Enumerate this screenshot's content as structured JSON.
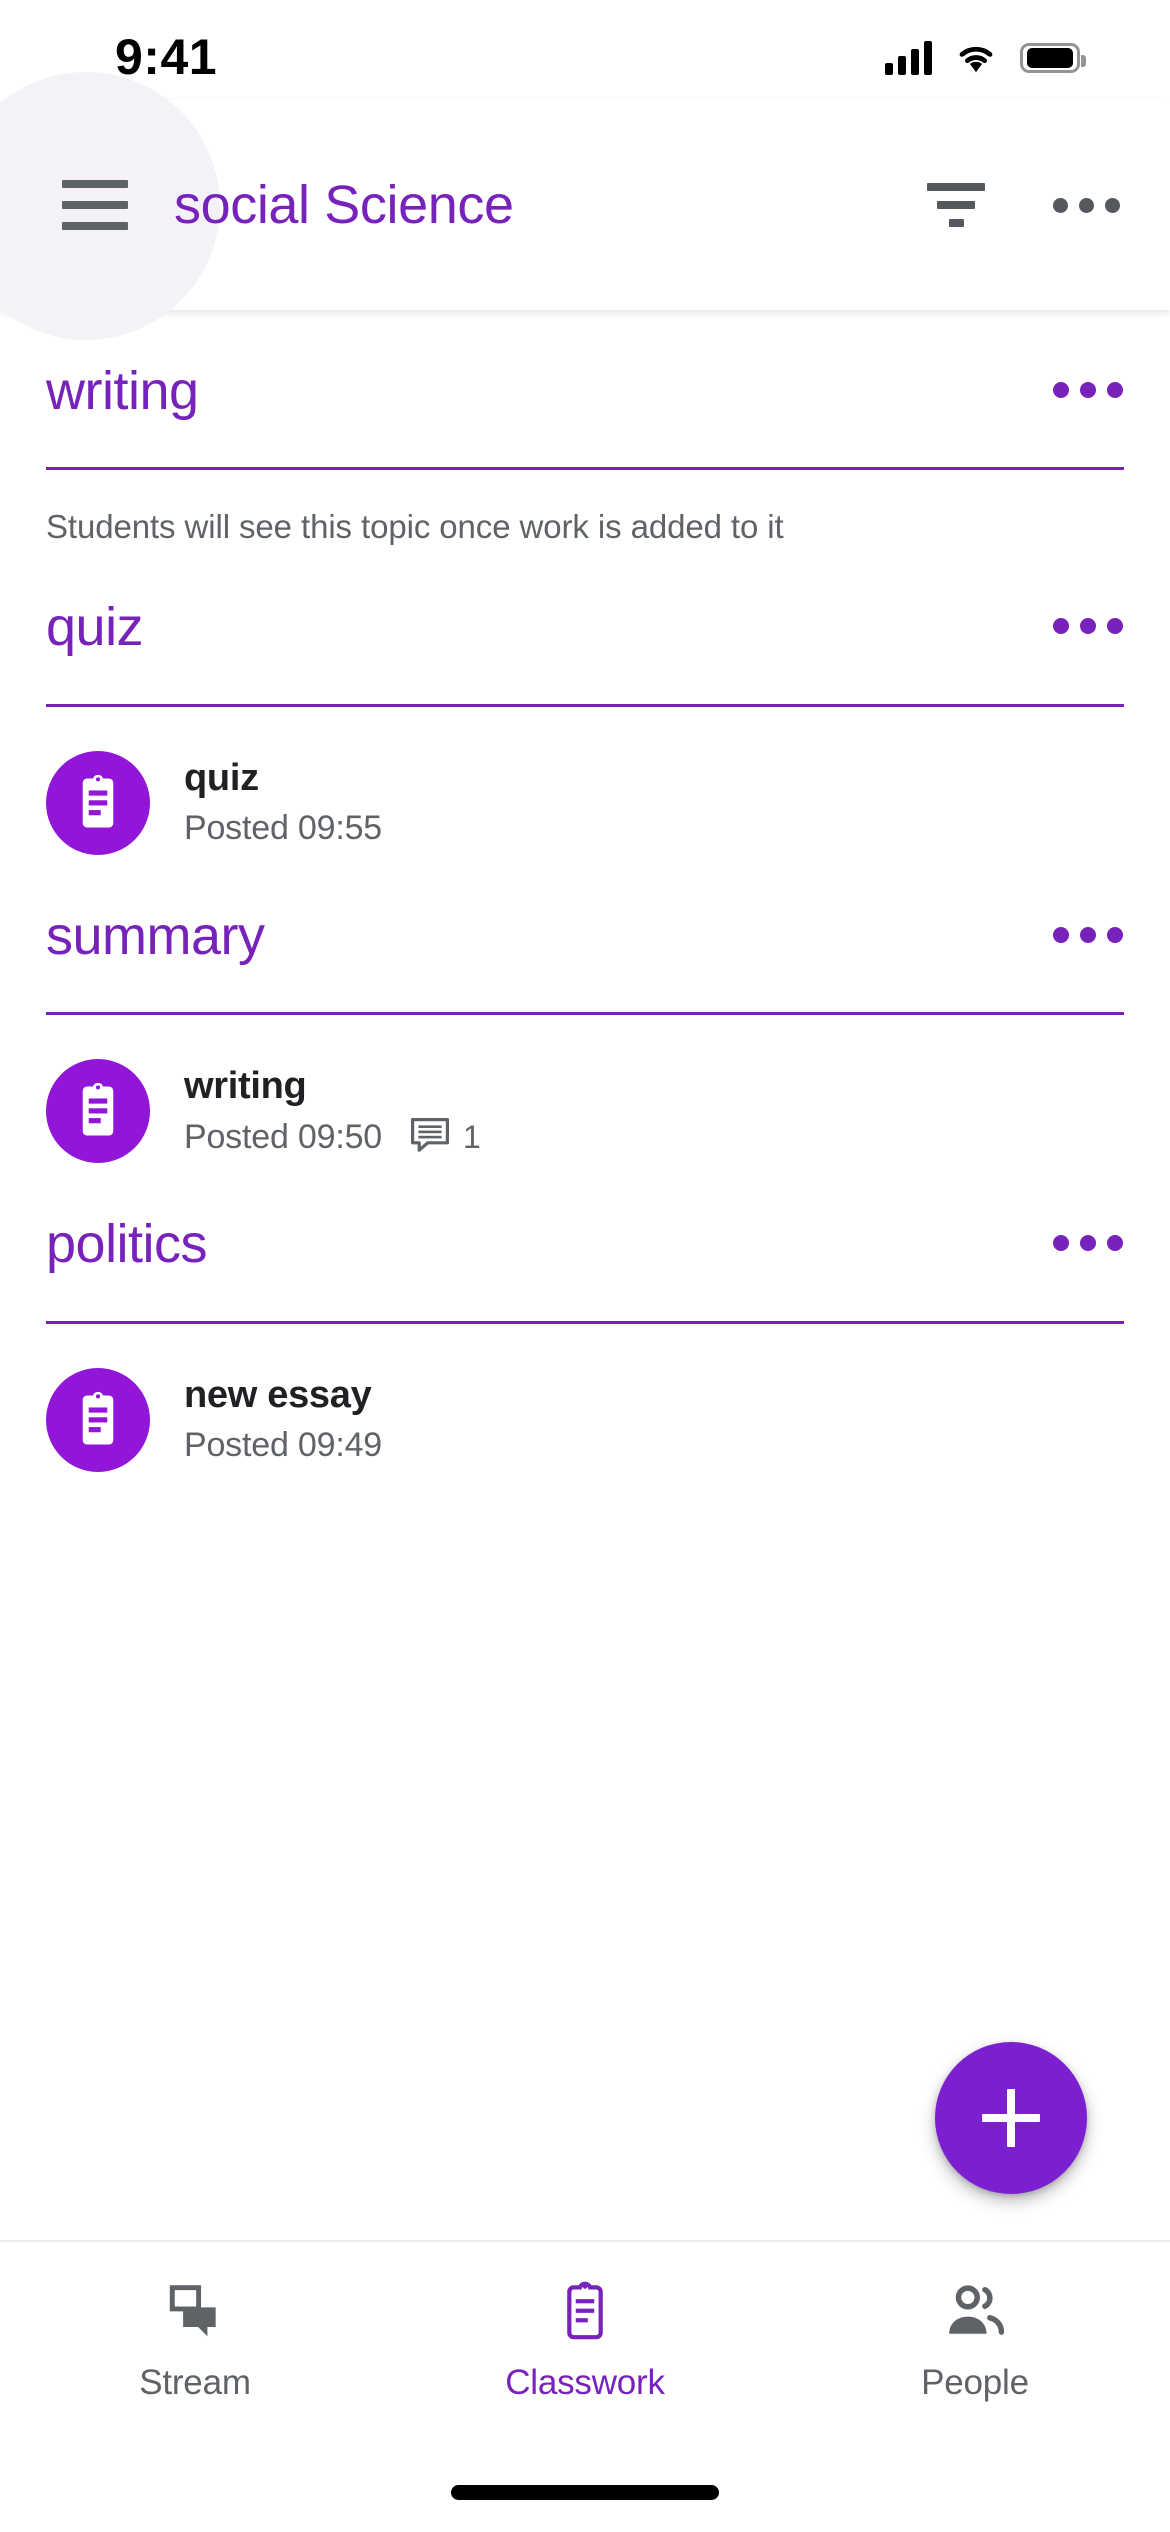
{
  "status_bar": {
    "time": "9:41",
    "signal_icon": "cellular-signal-icon",
    "wifi_icon": "wifi-icon",
    "battery_icon": "battery-icon"
  },
  "app_bar": {
    "menu_icon": "hamburger-menu-icon",
    "title": "social Science",
    "filter_icon": "filter-icon",
    "overflow_icon": "more-options-icon",
    "accent_color": "#7722bb"
  },
  "topics": [
    {
      "title": "writing",
      "overflow_label": "•••",
      "empty_message": "Students will see this topic once work is added to it",
      "items": []
    },
    {
      "title": "quiz",
      "overflow_label": "•••",
      "empty_message": "",
      "items": [
        {
          "icon": "assignment-clipboard-icon",
          "title": "quiz",
          "posted": "Posted 09:55",
          "comment_count": ""
        }
      ]
    },
    {
      "title": "summary",
      "overflow_label": "•••",
      "empty_message": "",
      "items": [
        {
          "icon": "assignment-clipboard-icon",
          "title": "writing",
          "posted": "Posted 09:50",
          "comment_count": "1"
        }
      ]
    },
    {
      "title": "politics",
      "overflow_label": "•••",
      "empty_message": "",
      "items": [
        {
          "icon": "assignment-clipboard-icon",
          "title": "new essay",
          "posted": "Posted 09:49",
          "comment_count": ""
        }
      ]
    }
  ],
  "fab": {
    "icon": "plus-icon",
    "color": "#7b1fd0"
  },
  "bottom_nav": {
    "items": [
      {
        "label": "Stream",
        "icon": "stream-chat-icon",
        "active": false
      },
      {
        "label": "Classwork",
        "icon": "clipboard-icon",
        "active": true
      },
      {
        "label": "People",
        "icon": "people-icon",
        "active": false
      }
    ]
  }
}
